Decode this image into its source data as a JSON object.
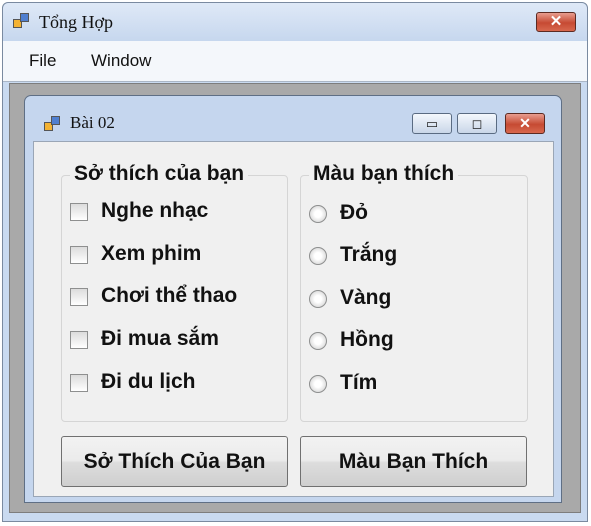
{
  "main_window": {
    "title": "Tổng Hợp",
    "close_glyph": "✕",
    "icon": "app-icon"
  },
  "menubar": {
    "items": [
      {
        "label": "File"
      },
      {
        "label": "Window"
      }
    ]
  },
  "child_window": {
    "title": "Bài 02",
    "minimize_glyph": "▭",
    "maximize_glyph": "◻",
    "close_glyph": "✕",
    "icon": "app-icon"
  },
  "hobbies_group": {
    "title": "Sở thích của bạn",
    "options": [
      {
        "label": "Nghe nhạc",
        "checked": false
      },
      {
        "label": "Xem phim",
        "checked": false
      },
      {
        "label": "Chơi thể thao",
        "checked": false
      },
      {
        "label": "Đi mua sắm",
        "checked": false
      },
      {
        "label": "Đi du lịch",
        "checked": false
      }
    ]
  },
  "colors_group": {
    "title": "Màu bạn thích",
    "options": [
      {
        "label": "Đỏ",
        "selected": false
      },
      {
        "label": "Trắng",
        "selected": false
      },
      {
        "label": "Vàng",
        "selected": false
      },
      {
        "label": "Hồng",
        "selected": false
      },
      {
        "label": "Tím",
        "selected": false
      }
    ]
  },
  "buttons": {
    "hobbies_label": "Sở Thích Của Bạn",
    "colors_label": "Màu Bạn Thích"
  },
  "colors": {
    "titlebar": "#c6d7ee",
    "mdi_background": "#a9a9a9",
    "close_button": "#c64a33",
    "client": "#f0f0f0"
  }
}
